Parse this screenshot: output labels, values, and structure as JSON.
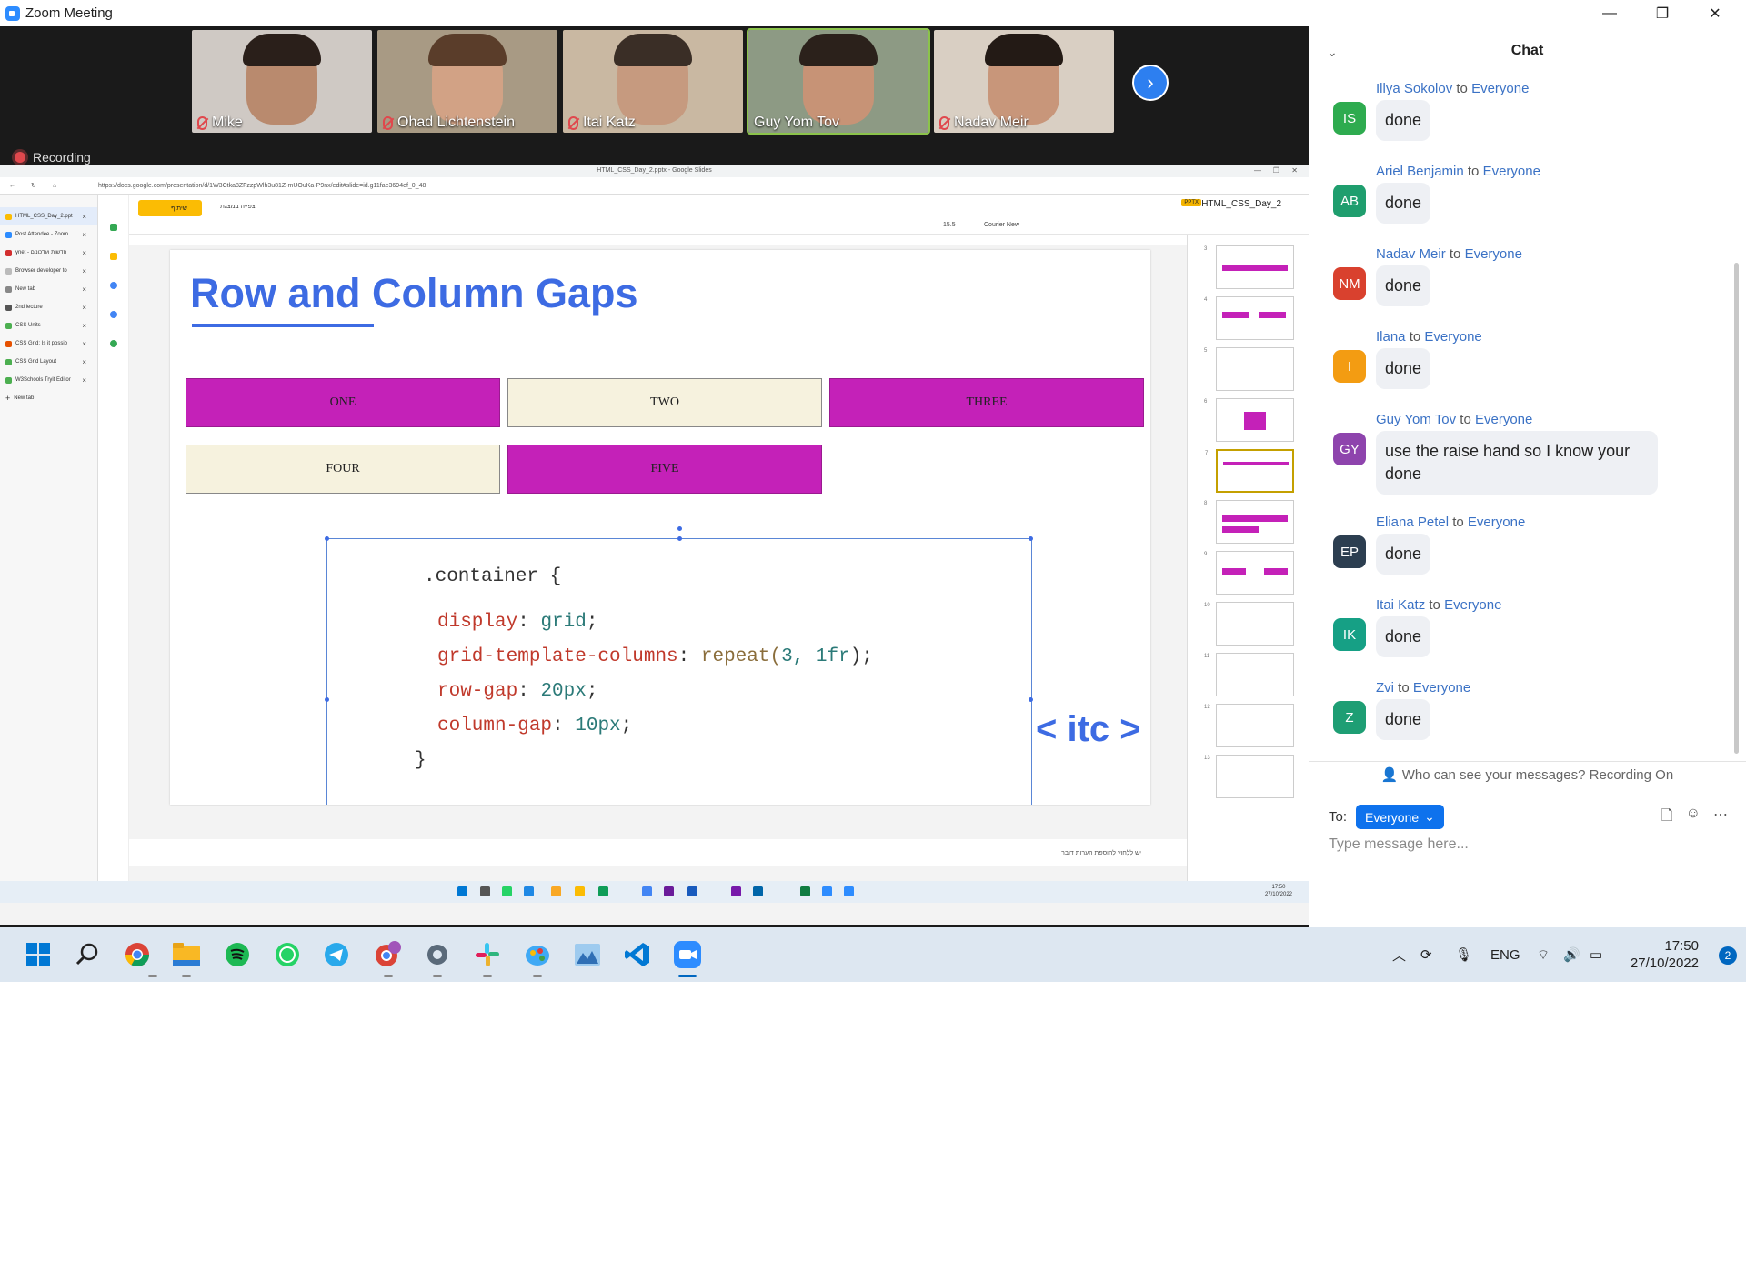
{
  "window": {
    "title": "Zoom Meeting",
    "minimize": "—",
    "restore": "❐",
    "close": "✕"
  },
  "participants": [
    {
      "name": "Mike"
    },
    {
      "name": "Ohad Lichtenstein"
    },
    {
      "name": "Itai Katz"
    },
    {
      "name": "Guy Yom Tov",
      "active": true
    },
    {
      "name": "Nadav Meir"
    }
  ],
  "recording": "Recording",
  "shared_screen": {
    "tab_title": "HTML_CSS_Day_2.pptx - Google Slides",
    "url": "https://docs.google.com/presentation/d/1W3Ctka8ZFzzpWlh3u81Z-mUOuKa-P9nx/edit#slide=id.g11fae3694ef_0_48",
    "side_tabs": [
      "HTML_CSS_Day_2.ppt",
      "Post Attendee - Zoom",
      "ynet - חדשות ועדכונים",
      "Browser developer to",
      "New tab",
      "2nd lecture",
      "CSS Units",
      "CSS Grid: Is it possib",
      "CSS Grid Layout",
      "W3Schools Tryit Editor",
      "New tab"
    ],
    "share_label": "שיתוף",
    "present_label": "צפייה במצגת",
    "doc_title": "HTML_CSS_Day_2",
    "doc_badge": "PPTX",
    "font_name": "Courier New",
    "font_size": "15.5",
    "notes_hint": "יש ללחוץ להוספת הערות דובר",
    "slide": {
      "title": "Row and Column Gaps",
      "boxes": [
        "ONE",
        "TWO",
        "THREE",
        "FOUR",
        "FIVE"
      ],
      "code": {
        "open": ".container {",
        "l1_prop": "display",
        "l1_val": "grid",
        "l2_prop": "grid-template-columns",
        "l2_fn": "repeat(",
        "l2_val": "3, 1fr",
        "l2_end": ");",
        "l3_prop": "row-gap",
        "l3_val": "20px",
        "l4_prop": "column-gap",
        "l4_val": "10px",
        "close": "}"
      },
      "logo": "< itc >"
    },
    "thumb_numbers": [
      "3",
      "4",
      "5",
      "6",
      "7",
      "8",
      "9",
      "10",
      "11",
      "12",
      "13"
    ],
    "mini_clock": {
      "time": "17:50",
      "date": "27/10/2022"
    }
  },
  "chat": {
    "title": "Chat",
    "to_label": "to",
    "messages": [
      {
        "sender": "Illya Sokolov",
        "recipient": "Everyone",
        "initials": "IS",
        "color": "#2eab4f",
        "text": "done"
      },
      {
        "sender": "Ariel Benjamin",
        "recipient": "Everyone",
        "initials": "AB",
        "color": "#1f9e6e",
        "text": "done"
      },
      {
        "sender": "Nadav Meir",
        "recipient": "Everyone",
        "initials": "NM",
        "color": "#d9412e",
        "text": "done"
      },
      {
        "sender": "Ilana",
        "recipient": "Everyone",
        "initials": "I",
        "color": "#f39c12",
        "text": "done"
      },
      {
        "sender": "Guy Yom Tov",
        "recipient": "Everyone",
        "initials": "GY",
        "color": "#8e44ad",
        "text": "use the raise hand so I know your done"
      },
      {
        "sender": "Eliana Petel",
        "recipient": "Everyone",
        "initials": "EP",
        "color": "#2c3e50",
        "text": "done"
      },
      {
        "sender": "Itai Katz",
        "recipient": "Everyone",
        "initials": "IK",
        "color": "#16a085",
        "text": "done"
      },
      {
        "sender": "Zvi",
        "recipient": "Everyone",
        "initials": "Z",
        "color": "#1e9e74",
        "text": "done"
      }
    ],
    "privacy_note": "Who can see your messages? Recording On",
    "to_prefix": "To:",
    "to_target": "Everyone",
    "input_placeholder": "Type message here..."
  },
  "taskbar": {
    "language": "ENG",
    "time": "17:50",
    "date": "27/10/2022",
    "notifications": "2",
    "apps": [
      "start-icon",
      "search-icon",
      "chrome-icon",
      "file-explorer-icon",
      "spotify-icon",
      "whatsapp-icon",
      "telegram-icon",
      "chrome-profile-icon",
      "settings-icon",
      "slack-icon",
      "paint-icon",
      "photos-icon",
      "vscode-icon",
      "zoom-icon"
    ]
  }
}
